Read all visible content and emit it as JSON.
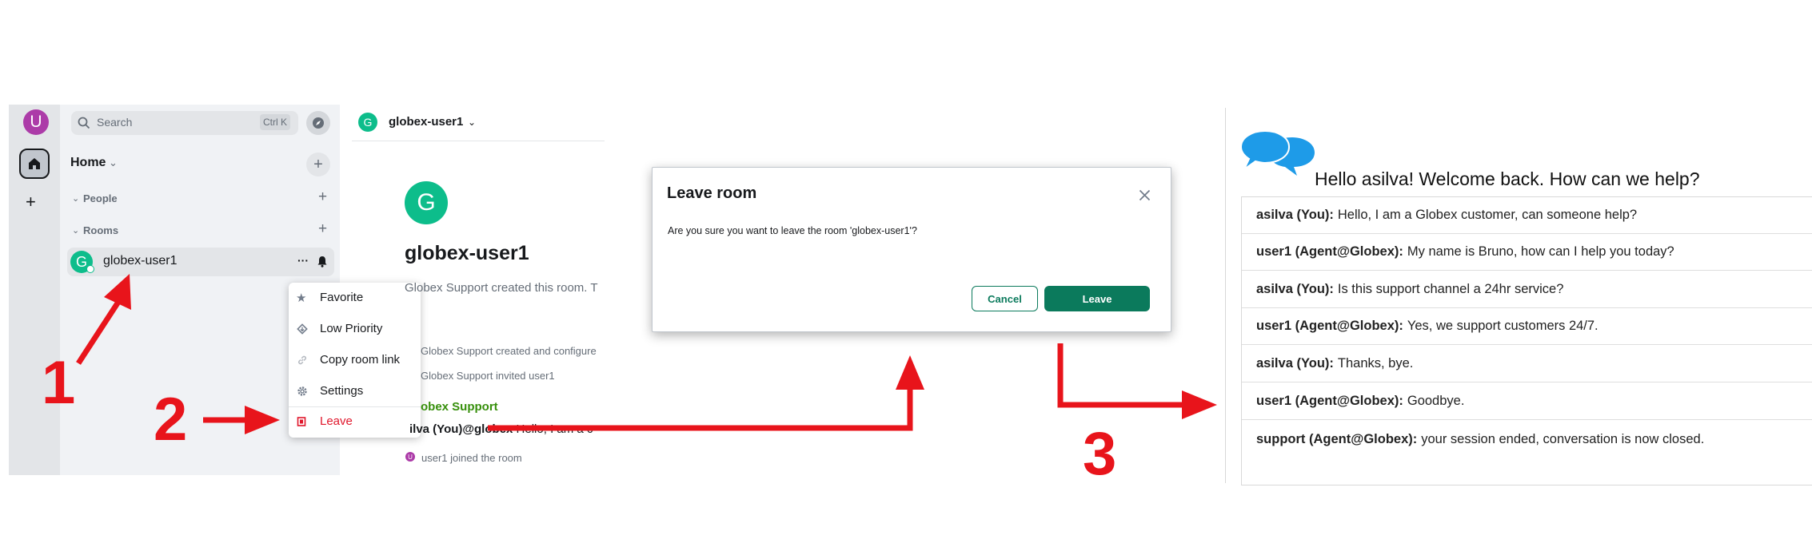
{
  "panel1": {
    "user_initial": "U",
    "search": {
      "placeholder": "Search",
      "shortcut": "Ctrl K"
    },
    "home_label": "Home",
    "sections": {
      "people": "People",
      "rooms": "Rooms"
    },
    "room": {
      "initial": "G",
      "name": "globex-user1",
      "more": "···"
    },
    "context_menu": [
      {
        "label": "Favorite",
        "icon": "star-icon"
      },
      {
        "label": "Low Priority",
        "icon": "low-priority-icon"
      },
      {
        "label": "Copy room link",
        "icon": "link-icon"
      },
      {
        "label": "Settings",
        "icon": "gear-icon"
      },
      {
        "label": "Leave",
        "icon": "leave-icon"
      }
    ]
  },
  "panel2": {
    "header_room": "globex-user1",
    "big_initial": "G",
    "room_title": "globex-user1",
    "created_text": "Globex Support created this room. T",
    "timeline": {
      "configured": "Globex Support created and configure",
      "invited": "Globex Support invited user1",
      "sender": "obex Support",
      "message_sender": "ilva (You)@globex",
      "message_text": "Hello, I am a c",
      "joined": "user1 joined the room",
      "joined_initial": "U"
    },
    "dialog": {
      "title": "Leave room",
      "body": "Are you sure you want to leave the room 'globex-user1'?",
      "cancel": "Cancel",
      "leave": "Leave"
    }
  },
  "panel3": {
    "greeting": "Hello asilva! Welcome back. How can we help?",
    "messages": [
      {
        "sender": "asilva (You):",
        "text": "Hello, I am a Globex customer, can someone help?"
      },
      {
        "sender": "user1 (Agent@Globex):",
        "text": "My name is Bruno, how can I help you today?"
      },
      {
        "sender": "asilva (You):",
        "text": "Is this support channel a 24hr service?"
      },
      {
        "sender": "user1 (Agent@Globex):",
        "text": "Yes, we support customers 24/7."
      },
      {
        "sender": "asilva (You):",
        "text": "Thanks, bye."
      },
      {
        "sender": "user1 (Agent@Globex):",
        "text": "Goodbye."
      },
      {
        "sender": "support (Agent@Globex):",
        "text": "your session ended, conversation is now closed."
      }
    ]
  },
  "annotations": {
    "step1": "1",
    "step2": "2",
    "step3": "3"
  },
  "colors": {
    "accent_green": "#0b7a5c",
    "leave_red": "#e0162b",
    "arrow_red": "#e8141b",
    "avatar_purple": "#ac3ba8",
    "room_avatar_green": "#0dbd8b",
    "chat_icon_blue": "#1e9be8"
  }
}
